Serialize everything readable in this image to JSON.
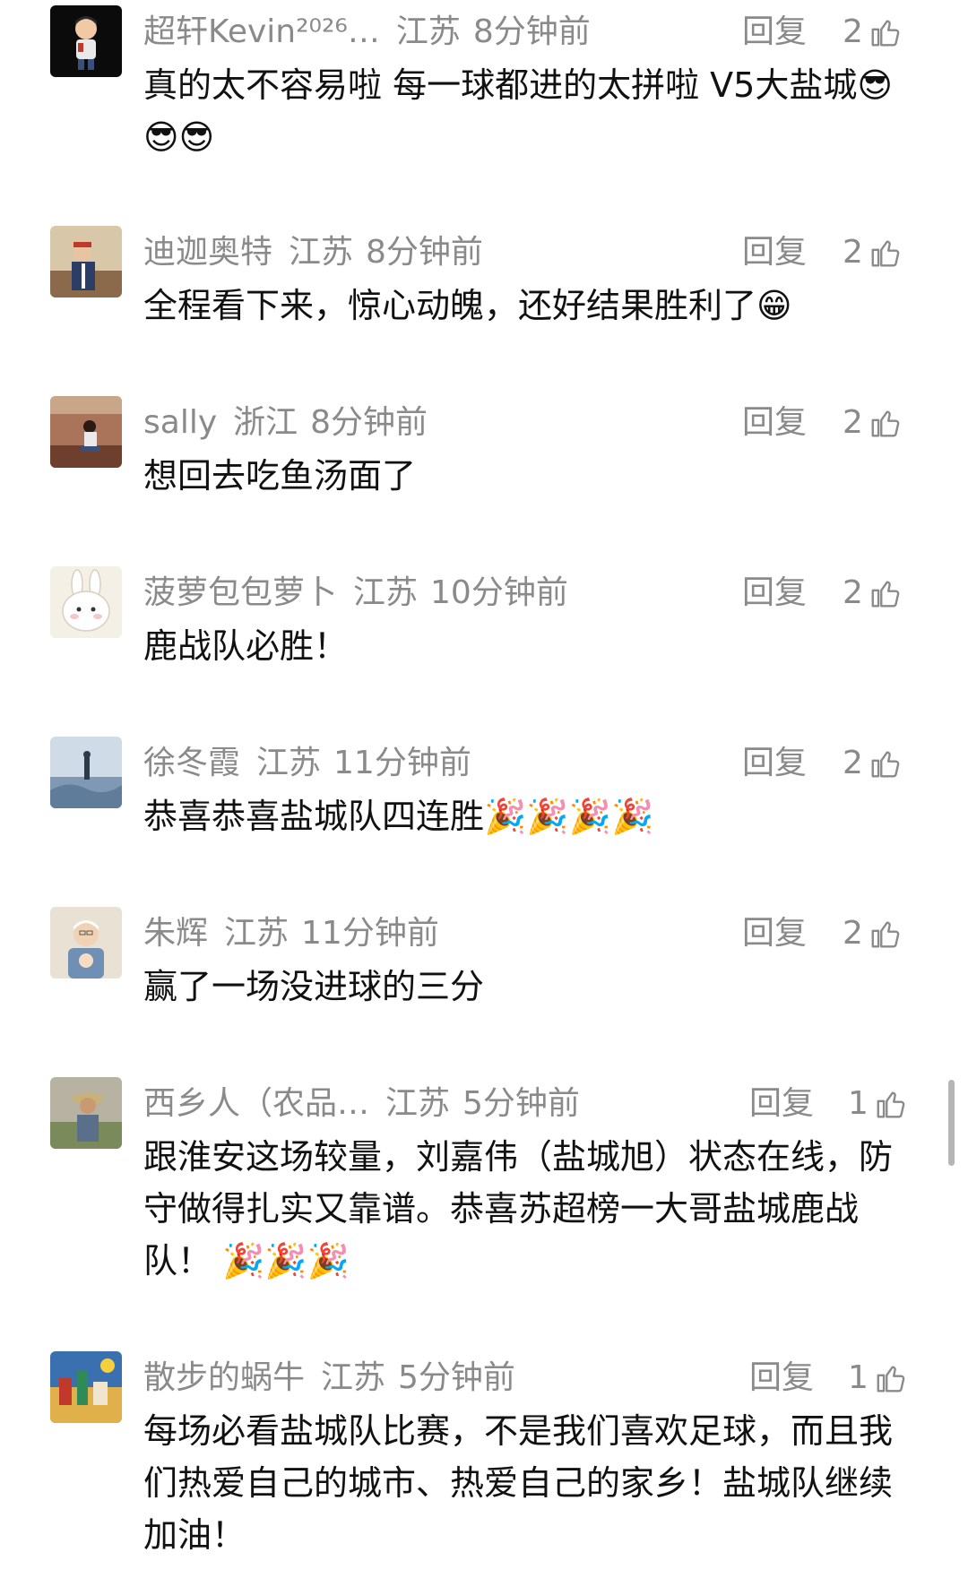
{
  "comments": [
    {
      "name": "超轩Kevin²⁰²⁶…",
      "location": "江苏",
      "time": "8分钟前",
      "reply": "回复",
      "likes": "2",
      "text": "真的太不容易啦  每一球都进的太拼啦  V5大盐城😎😎😎",
      "avatar_icon": "boy-cartoon-avatar"
    },
    {
      "name": "迪迦奥特",
      "location": "江苏",
      "time": "8分钟前",
      "reply": "回复",
      "likes": "2",
      "text": "全程看下来，惊心动魄，还好结果胜利了😁",
      "avatar_icon": "uniform-photo-avatar"
    },
    {
      "name": "sally",
      "location": "浙江",
      "time": "8分钟前",
      "reply": "回复",
      "likes": "2",
      "text": "想回去吃鱼汤面了",
      "avatar_icon": "sitting-person-avatar"
    },
    {
      "name": "菠萝包包萝卜",
      "location": "江苏",
      "time": "10分钟前",
      "reply": "回复",
      "likes": "2",
      "text": "鹿战队必胜！",
      "avatar_icon": "bunny-avatar"
    },
    {
      "name": "徐冬霞",
      "location": "江苏",
      "time": "11分钟前",
      "reply": "回复",
      "likes": "2",
      "text": "恭喜恭喜盐城队四连胜🎉🎉🎉🎉",
      "avatar_icon": "landscape-avatar"
    },
    {
      "name": "朱辉",
      "location": "江苏",
      "time": "11分钟前",
      "reply": "回复",
      "likes": "2",
      "text": "赢了一场没进球的三分",
      "avatar_icon": "grandpa-baby-avatar"
    },
    {
      "name": "西乡人（农品…",
      "location": "江苏",
      "time": "5分钟前",
      "reply": "回复",
      "likes": "1",
      "text": " 跟淮安这场较量，刘嘉伟（盐城旭）状态在线，防守做得扎实又靠谱。恭喜苏超榜一大哥盐城鹿战队！ 🎉🎉🎉",
      "avatar_icon": "farmer-avatar"
    },
    {
      "name": "散步的蜗牛",
      "location": "江苏",
      "time": "5分钟前",
      "reply": "回复",
      "likes": "1",
      "text": "每场必看盐城队比赛，不是我们喜欢足球，而且我们热爱自己的城市、热爱自己的家乡！盐城队继续加油！",
      "avatar_icon": "painting-avatar"
    }
  ],
  "colors": {
    "meta_gray": "#8a8a8a",
    "text_black": "#111111",
    "scrollbar": "#b5b5b5"
  }
}
